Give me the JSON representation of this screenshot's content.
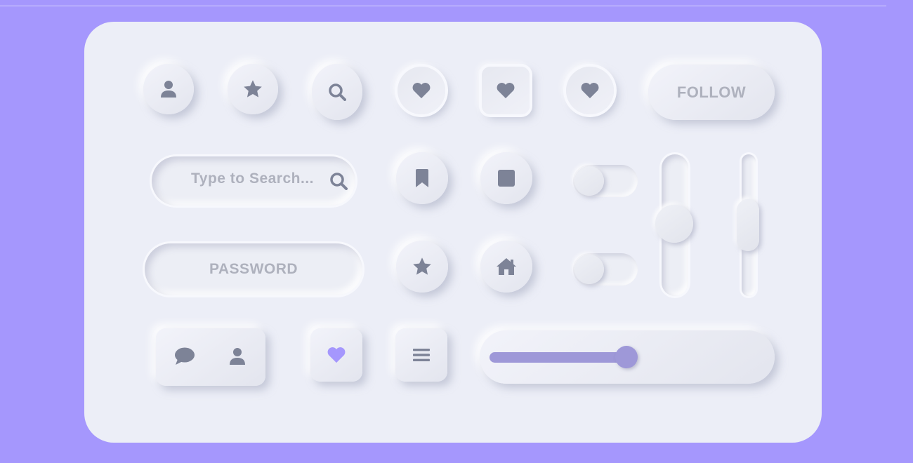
{
  "colors": {
    "background": "#a597fd",
    "card": "#eceef7",
    "icon": "#7d8397",
    "text": "#aeb1bd",
    "accent": "#a597fd",
    "slider_fill": "#9e98d8"
  },
  "row1": {
    "icons": [
      "user-icon",
      "star-icon",
      "search-icon",
      "heart-icon",
      "heart-icon",
      "heart-icon"
    ],
    "follow_label": "FOLLOW"
  },
  "search": {
    "placeholder": "Type to Search...",
    "icon": "search-icon"
  },
  "password": {
    "label": "PASSWORD"
  },
  "toggles": [
    {
      "on": false
    },
    {
      "on": false
    }
  ],
  "vertical_sliders": [
    {
      "value_fraction": 0.4
    },
    {
      "value_fraction": 0.5
    }
  ],
  "bottom": {
    "group_icons": [
      "chat-icon",
      "user-icon"
    ],
    "heart_icon": "heart-icon",
    "menu_icon": "menu-icon"
  },
  "range_slider": {
    "value_fraction": 0.47
  }
}
